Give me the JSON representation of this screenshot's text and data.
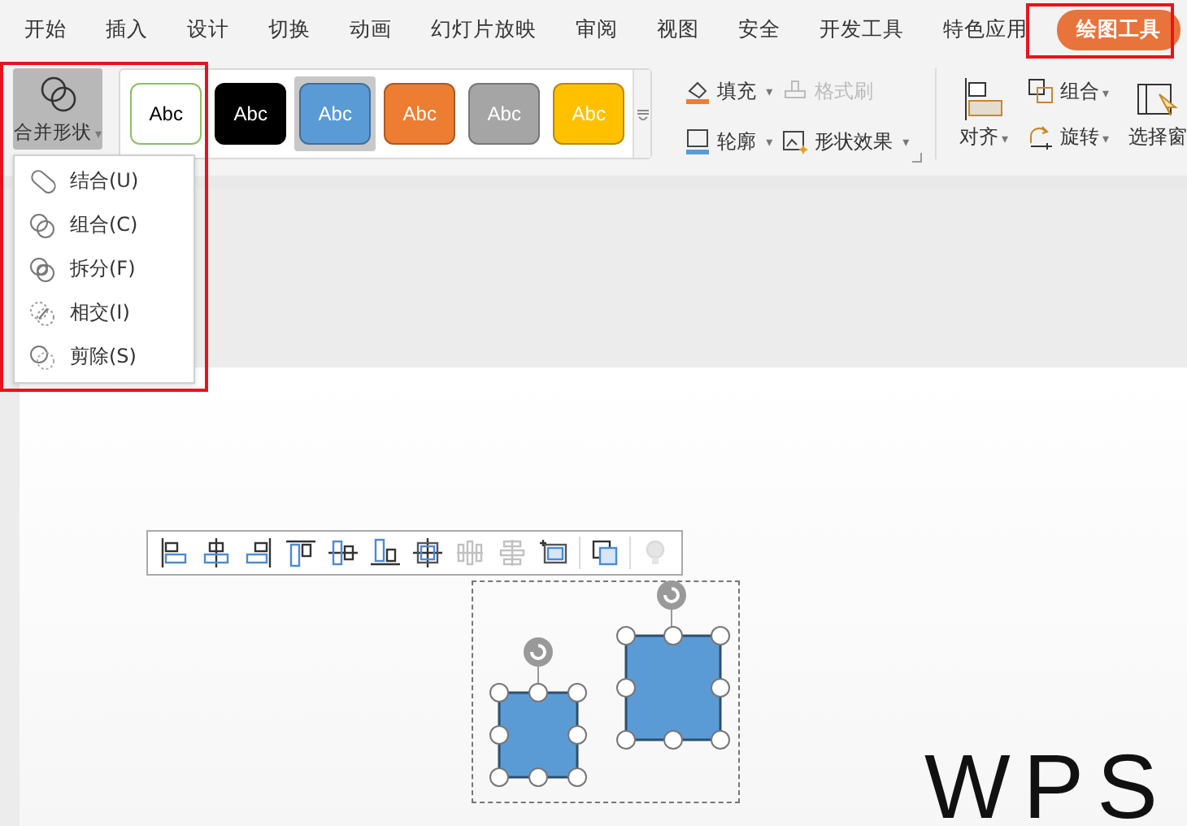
{
  "tabs": [
    {
      "label": "开始",
      "selected": false
    },
    {
      "label": "插入",
      "selected": false
    },
    {
      "label": "设计",
      "selected": false
    },
    {
      "label": "切换",
      "selected": false
    },
    {
      "label": "动画",
      "selected": false
    },
    {
      "label": "幻灯片放映",
      "selected": false
    },
    {
      "label": "审阅",
      "selected": false
    },
    {
      "label": "视图",
      "selected": false
    },
    {
      "label": "安全",
      "selected": false
    },
    {
      "label": "开发工具",
      "selected": false
    },
    {
      "label": "特色应用",
      "selected": false
    },
    {
      "label": "绘图工具",
      "selected": true
    }
  ],
  "merge_shapes": {
    "label": "合并形状",
    "expanded": true,
    "caret": "▾"
  },
  "style_gallery": [
    {
      "label": "Abc",
      "kind": "outline",
      "color": "#8cbf6a",
      "selected": false
    },
    {
      "label": "Abc",
      "kind": "filled",
      "color": "#000000",
      "selected": false
    },
    {
      "label": "Abc",
      "kind": "filled",
      "color": "#5b9bd5",
      "selected": true
    },
    {
      "label": "Abc",
      "kind": "filled",
      "color": "#ed7d31",
      "selected": false
    },
    {
      "label": "Abc",
      "kind": "filled",
      "color": "#a5a5a5",
      "selected": false
    },
    {
      "label": "Abc",
      "kind": "filled",
      "color": "#ffc000",
      "selected": false
    }
  ],
  "commands": [
    {
      "kind": "fill",
      "label": "填充",
      "caret": "▾",
      "disabled": false
    },
    {
      "kind": "format-painter",
      "label": "格式刷",
      "disabled": true
    },
    {
      "kind": "outline",
      "label": "轮廓",
      "caret": "▾",
      "disabled": false
    },
    {
      "kind": "effects",
      "label": "形状效果",
      "caret": "▾",
      "disabled": false
    }
  ],
  "arrange": [
    {
      "kind": "align",
      "label": "对齐",
      "caret": "▾"
    },
    {
      "kind": "group",
      "label": "组合",
      "caret": "▾"
    },
    {
      "kind": "rotate",
      "label": "旋转",
      "caret": "▾"
    },
    {
      "kind": "pane",
      "label": "选择窗"
    }
  ],
  "merge_menu": [
    {
      "kind": "union",
      "label": "结合(U)"
    },
    {
      "kind": "combine",
      "label": "组合(C)"
    },
    {
      "kind": "fragment",
      "label": "拆分(F)"
    },
    {
      "kind": "intersect",
      "label": "相交(I)"
    },
    {
      "kind": "subtract",
      "label": "剪除(S)"
    }
  ],
  "align_toolbar": [
    {
      "kind": "align-left",
      "disabled": false
    },
    {
      "kind": "align-center",
      "disabled": false
    },
    {
      "kind": "align-right",
      "disabled": false
    },
    {
      "kind": "align-top",
      "disabled": false
    },
    {
      "kind": "align-middle",
      "disabled": false
    },
    {
      "kind": "align-bottom",
      "disabled": false
    },
    {
      "kind": "center-both",
      "disabled": false
    },
    {
      "kind": "distribute-h",
      "disabled": true
    },
    {
      "kind": "distribute-v",
      "disabled": true
    },
    {
      "kind": "fit-slide",
      "disabled": false
    },
    {
      "kind": "arrange",
      "disabled": false
    },
    {
      "kind": "tip",
      "disabled": true
    }
  ],
  "slide": {
    "title": "WPS"
  }
}
